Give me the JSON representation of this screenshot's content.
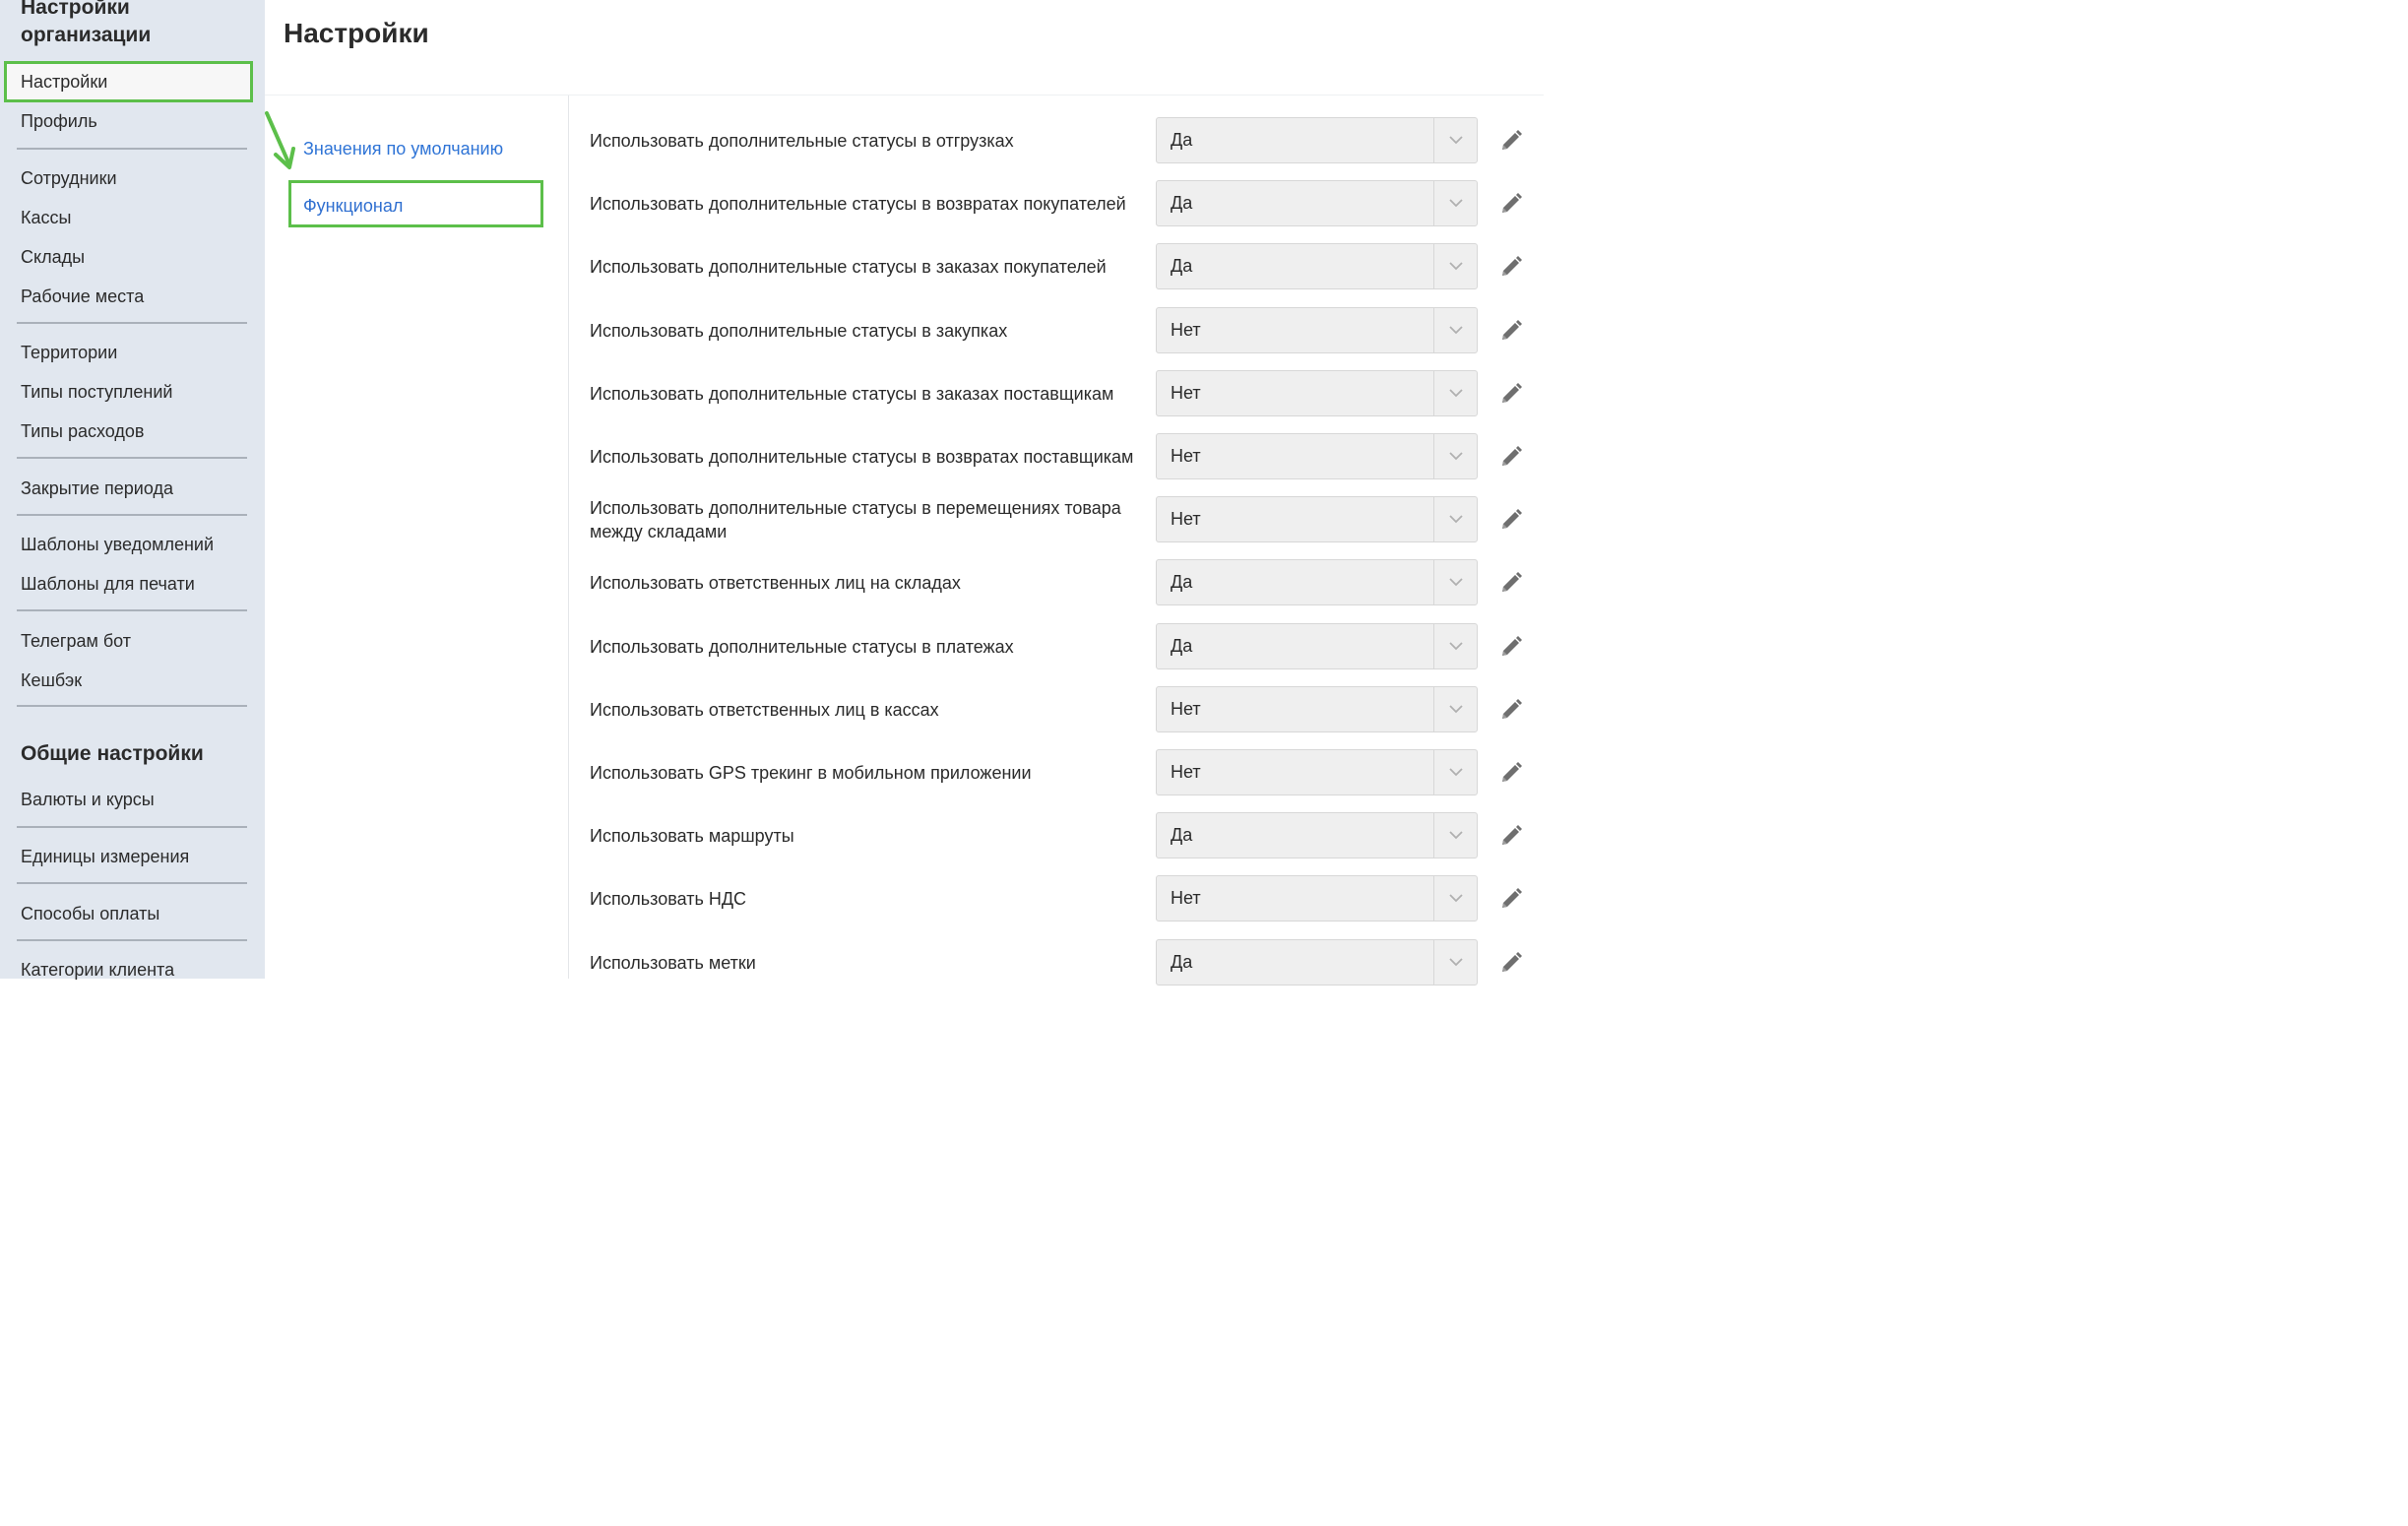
{
  "sidebar": {
    "title": "Настройки организации",
    "active_item": "Настройки",
    "items": [
      "Профиль",
      "Сотрудники",
      "Кассы",
      "Склады",
      "Рабочие места",
      "Территории",
      "Типы поступлений",
      "Типы расходов",
      "Закрытие периода",
      "Шаблоны уведомлений",
      "Шаблоны для печати",
      "Телеграм бот",
      "Кешбэк"
    ],
    "section2_title": "Общие настройки",
    "section2_items": [
      "Валюты и курсы",
      "Единицы измерения",
      "Способы оплаты",
      "Категории клиента"
    ]
  },
  "main": {
    "title": "Настройки",
    "subnav": {
      "defaults_link": "Значения по умолчанию",
      "active_item": "Функционал"
    },
    "settings": [
      {
        "label": "Использовать дополнительные статусы в отгрузках",
        "value": "Да"
      },
      {
        "label": "Использовать дополнительные статусы в возвратах покупателей",
        "value": "Да"
      },
      {
        "label": "Использовать дополнительные статусы в заказах покупателей",
        "value": "Да"
      },
      {
        "label": "Использовать дополнительные статусы в закупках",
        "value": "Нет"
      },
      {
        "label": "Использовать дополнительные статусы в заказах поставщикам",
        "value": "Нет"
      },
      {
        "label": "Использовать дополнительные статусы в возвратах поставщикам",
        "value": "Нет"
      },
      {
        "label": "Использовать дополнительные статусы в перемещениях товара между складами",
        "value": "Нет"
      },
      {
        "label": "Использовать ответственных лиц на складах",
        "value": "Да"
      },
      {
        "label": "Использовать дополнительные статусы в платежах",
        "value": "Да"
      },
      {
        "label": "Использовать ответственных лиц в кассах",
        "value": "Нет"
      },
      {
        "label": "Использовать GPS трекинг в мобильном приложении",
        "value": "Нет"
      },
      {
        "label": "Использовать маршруты",
        "value": "Да"
      },
      {
        "label": "Использовать НДС",
        "value": "Нет"
      },
      {
        "label": "Использовать метки",
        "value": "Да"
      }
    ]
  },
  "colors": {
    "highlight": "#5cbf4a",
    "link": "#2f74d6",
    "sidebar_bg": "#e1e7ef"
  },
  "icons": {
    "edit": "pencil-icon",
    "dropdown": "chevron-down-icon",
    "annotation": "green-arrow"
  }
}
